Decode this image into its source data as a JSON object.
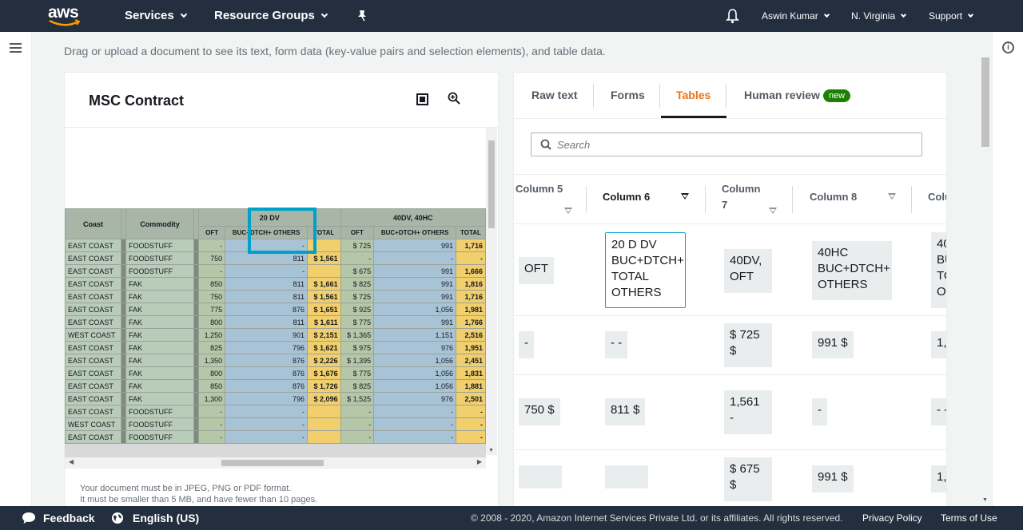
{
  "topnav": {
    "logo": "aws",
    "services": "Services",
    "resource_groups": "Resource Groups",
    "user": "Aswin Kumar",
    "region": "N. Virginia",
    "support": "Support"
  },
  "intro": "Drag or upload a document to see its text, form data (key-value pairs and selection elements), and table data.",
  "document": {
    "title": "MSC Contract",
    "header_row1": [
      "Coast",
      "Commodity",
      "20 DV",
      "40DV, 40HC"
    ],
    "header_row2": [
      "OFT",
      "BUC+DTCH+ OTHERS",
      "TOTAL",
      "OFT",
      "BUC+DTCH+ OTHERS",
      "TOTAL"
    ],
    "rows": [
      [
        "EAST COAST",
        "FOODSTUFF",
        "-",
        "-",
        "",
        "$ 725",
        "991",
        "1,716"
      ],
      [
        "EAST COAST",
        "FOODSTUFF",
        "750",
        "811",
        "$ 1,561",
        "-",
        "-",
        "-"
      ],
      [
        "EAST COAST",
        "FOODSTUFF",
        "-",
        "-",
        "",
        "$ 675",
        "991",
        "1,666"
      ],
      [
        "EAST COAST",
        "FAK",
        "850",
        "811",
        "$ 1,661",
        "$ 825",
        "991",
        "1,816"
      ],
      [
        "EAST COAST",
        "FAK",
        "750",
        "811",
        "$ 1,561",
        "$ 725",
        "991",
        "1,716"
      ],
      [
        "EAST COAST",
        "FAK",
        "775",
        "876",
        "$ 1,651",
        "$ 925",
        "1,056",
        "1,981"
      ],
      [
        "EAST COAST",
        "FAK",
        "800",
        "811",
        "$ 1,611",
        "$ 775",
        "991",
        "1,766"
      ],
      [
        "WEST COAST",
        "FAK",
        "1,250",
        "901",
        "$ 2,151",
        "$ 1,365",
        "1,151",
        "2,516"
      ],
      [
        "EAST COAST",
        "FAK",
        "825",
        "796",
        "$ 1,621",
        "$ 975",
        "976",
        "1,951"
      ],
      [
        "EAST COAST",
        "FAK",
        "1,350",
        "876",
        "$ 2,226",
        "$ 1,395",
        "1,056",
        "2,451"
      ],
      [
        "EAST COAST",
        "FAK",
        "800",
        "876",
        "$ 1,676",
        "$ 775",
        "1,056",
        "1,831"
      ],
      [
        "EAST COAST",
        "FAK",
        "850",
        "876",
        "$ 1,726",
        "$ 825",
        "1,056",
        "1,881"
      ],
      [
        "EAST COAST",
        "FAK",
        "1,300",
        "796",
        "$ 2,096",
        "$ 1,525",
        "976",
        "2,501"
      ],
      [
        "EAST COAST",
        "FOODSTUFF",
        "-",
        "-",
        "",
        "-",
        "-",
        "-"
      ],
      [
        "WEST COAST",
        "FOODSTUFF",
        "-",
        "-",
        "",
        "-",
        "-",
        "-"
      ],
      [
        "EAST COAST",
        "FOODSTUFF",
        "-",
        "-",
        "",
        "-",
        "-",
        "-"
      ]
    ],
    "note_line1": "Your document must be in JPEG, PNG or PDF format.",
    "note_line2": "It must be smaller than 5 MB, and have fewer than 10 pages."
  },
  "results": {
    "tabs": [
      "Raw text",
      "Forms",
      "Tables",
      "Human review"
    ],
    "active_tab": "Tables",
    "badge": "new",
    "search_placeholder": "Search",
    "columns": [
      "Column 5",
      "Column 6",
      "Column 7",
      "Column 8",
      "Colu"
    ],
    "cells": {
      "r1": [
        "OFT",
        "20 D DV BUC+DTCH+ TOTAL OTHERS",
        "40DV, OFT",
        "40HC BUC+DTCH+ OTHERS",
        "40 BU TO OT"
      ],
      "r2": [
        "-",
        "- -",
        "$ 725 $",
        "991 $",
        "1,"
      ],
      "r3": [
        "750 $",
        "811 $",
        "1,561 -",
        "-",
        "- -"
      ],
      "r4": [
        "",
        "",
        "$ 675 $",
        "991 $",
        "1,"
      ]
    }
  },
  "footer": {
    "feedback": "Feedback",
    "language": "English (US)",
    "copyright": "© 2008 - 2020, Amazon Internet Services Private Ltd. or its affiliates. All rights reserved.",
    "privacy": "Privacy Policy",
    "terms": "Terms of Use"
  }
}
